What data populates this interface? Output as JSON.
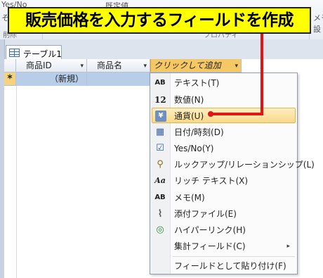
{
  "ribbon": {
    "left_text_1": "Yes/No",
    "left_text_2": "その他",
    "left_group": "削除",
    "mid_text": "既定値",
    "mid_group": "プロパティ",
    "right_text_1": "メモ",
    "right_text_2": "設"
  },
  "banner": {
    "text": "販売価格を入力するフィールドを作成"
  },
  "tab": {
    "label": "テーブル1"
  },
  "datasheet": {
    "columns": [
      {
        "label": "商品ID",
        "dropdown": "▾"
      },
      {
        "label": "商品名",
        "dropdown": "▾"
      },
      {
        "label": "クリックして追加",
        "dropdown": "▾"
      }
    ],
    "new_row_marker": "*",
    "new_row_id": "（新規）"
  },
  "menu": {
    "items": [
      {
        "icon": "AB",
        "icon_name": "text-icon",
        "label": "テキスト(T)",
        "highlighted": false,
        "submenu": false
      },
      {
        "icon": "12",
        "icon_name": "number-icon",
        "label": "数値(N)",
        "highlighted": false,
        "submenu": false
      },
      {
        "icon": "¥",
        "icon_name": "currency-icon",
        "label": "通貨(U)",
        "highlighted": true,
        "submenu": false
      },
      {
        "icon": "▦",
        "icon_name": "datetime-icon",
        "label": "日付/時刻(D)",
        "highlighted": false,
        "submenu": false
      },
      {
        "icon": "☑",
        "icon_name": "checkbox-icon",
        "label": "Yes/No(Y)",
        "highlighted": false,
        "submenu": false
      },
      {
        "icon": "⚲",
        "icon_name": "lookup-icon",
        "label": "ルックアップ/リレーションシップ(L)",
        "highlighted": false,
        "submenu": false
      },
      {
        "icon": "Aa",
        "icon_name": "rich-text-icon",
        "label": "リッチ テキスト(X)",
        "highlighted": false,
        "submenu": false
      },
      {
        "icon": "AB",
        "icon_name": "memo-icon",
        "label": "メモ(M)",
        "highlighted": false,
        "submenu": false
      },
      {
        "icon": "⌇",
        "icon_name": "paperclip-icon",
        "label": "添付ファイル(E)",
        "highlighted": false,
        "submenu": false
      },
      {
        "icon": "◎",
        "icon_name": "hyperlink-globe-icon",
        "label": "ハイパーリンク(H)",
        "highlighted": false,
        "submenu": false
      },
      {
        "icon": "",
        "icon_name": "",
        "label": "集計フィールド(C)",
        "highlighted": false,
        "submenu": true,
        "arrow": "▸"
      },
      {
        "icon": "",
        "icon_name": "",
        "label": "フィールドとして貼り付け(F)",
        "highlighted": false,
        "submenu": false
      }
    ]
  },
  "colors": {
    "banner_bg": "#ffff00",
    "pointer": "#e01515",
    "header_add_bg": "#f6c863",
    "menu_highlight": "#f9d987",
    "new_row_bg": "#b7cde8"
  }
}
